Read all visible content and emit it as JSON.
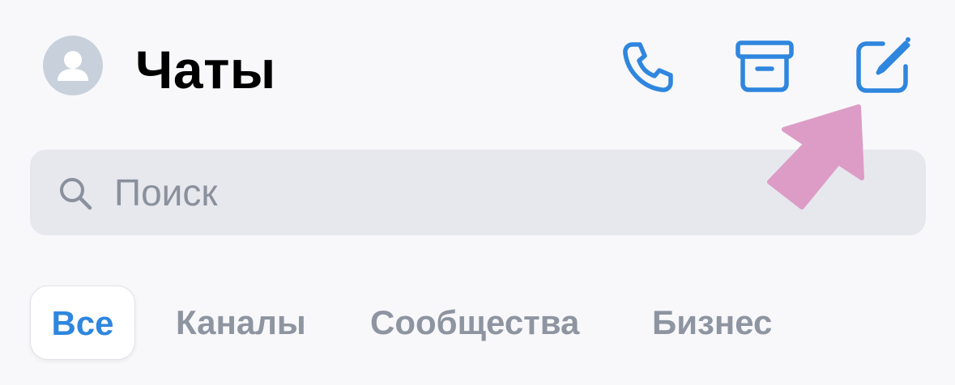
{
  "header": {
    "title": "Чаты",
    "avatar_icon": "person-icon",
    "actions": [
      {
        "name": "calls",
        "icon": "phone-icon"
      },
      {
        "name": "archive",
        "icon": "archive-icon"
      },
      {
        "name": "new-chat",
        "icon": "compose-icon"
      }
    ]
  },
  "search": {
    "placeholder": "Поиск",
    "value": "",
    "icon": "search-icon"
  },
  "tabs": [
    {
      "label": "Все",
      "active": true
    },
    {
      "label": "Каналы",
      "active": false
    },
    {
      "label": "Сообщества",
      "active": false
    },
    {
      "label": "Бизнес",
      "active": false
    }
  ],
  "annotation": {
    "icon": "pointer-arrow-icon"
  },
  "colors": {
    "accent": "#2f86de",
    "background": "#f8f8fa",
    "search_bg": "#e6e8ee",
    "inactive_tab": "#8e95a1",
    "avatar_bg": "#c8d0dc",
    "arrow": "#dc9cc6"
  }
}
